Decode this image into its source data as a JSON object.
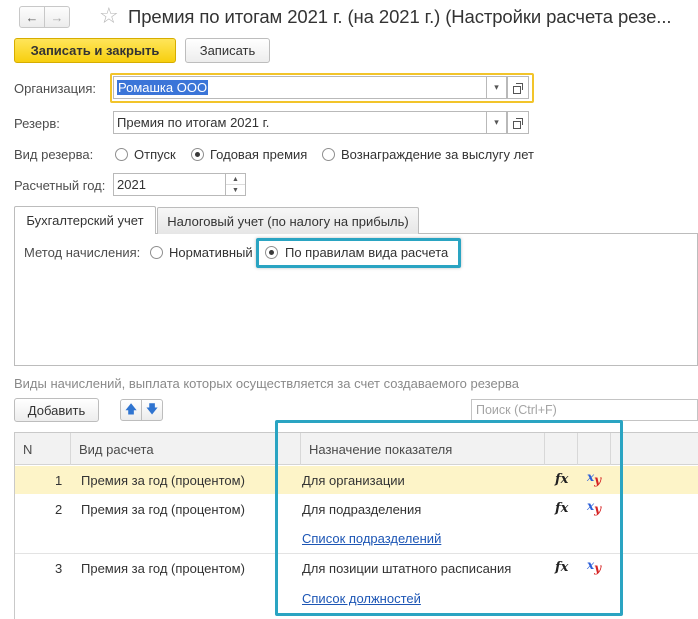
{
  "window": {
    "title": "Премия по итогам 2021 г. (на 2021 г.) (Настройки расчета резе...",
    "back_icon": "arrow-left-icon",
    "forward_icon": "arrow-right-icon",
    "favorite_icon": "star-icon"
  },
  "toolbar": {
    "save_close_label": "Записать и закрыть",
    "save_label": "Записать"
  },
  "form": {
    "organization_label": "Организация:",
    "organization_value": "Ромашка ООО",
    "reserve_label": "Резерв:",
    "reserve_value": "Премия по итогам 2021 г.",
    "reserve_type_label": "Вид резерва:",
    "reserve_type_options": [
      "Отпуск",
      "Годовая премия",
      "Вознаграждение за выслугу лет"
    ],
    "reserve_type_selected": "Годовая премия",
    "year_label": "Расчетный год:",
    "year_value": "2021"
  },
  "tabs": [
    {
      "label": "Бухгалтерский учет",
      "active": true
    },
    {
      "label": "Налоговый учет (по налогу на прибыль)",
      "active": false
    }
  ],
  "accounting": {
    "method_label": "Метод начисления:",
    "method_options": [
      "Нормативный",
      "По правилам вида расчета"
    ],
    "method_selected": "По правилам вида расчета"
  },
  "accruals": {
    "section_label": "Виды начислений, выплата которых осуществляется за счет создаваемого резерва",
    "add_label": "Добавить",
    "search_placeholder": "Поиск (Ctrl+F)",
    "columns": [
      "N",
      "Вид расчета",
      "Назначение показателя"
    ],
    "fx_symbol": "fx",
    "xy_symbol_x": "x",
    "xy_symbol_y": "y",
    "rows": [
      {
        "n": "1",
        "calc": "Премия за год (процентом)",
        "purpose": "Для организации",
        "link": ""
      },
      {
        "n": "2",
        "calc": "Премия за год (процентом)",
        "purpose": "Для подразделения",
        "link": "Список подразделений"
      },
      {
        "n": "3",
        "calc": "Премия за год (процентом)",
        "purpose": "Для позиции штатного расписания",
        "link": "Список должностей"
      }
    ]
  },
  "colors": {
    "accent_yellow": "#f7cf0e",
    "highlight_frame": "#2aa4c2",
    "selected_row": "#fdf4c8",
    "link": "#1d56b5"
  }
}
